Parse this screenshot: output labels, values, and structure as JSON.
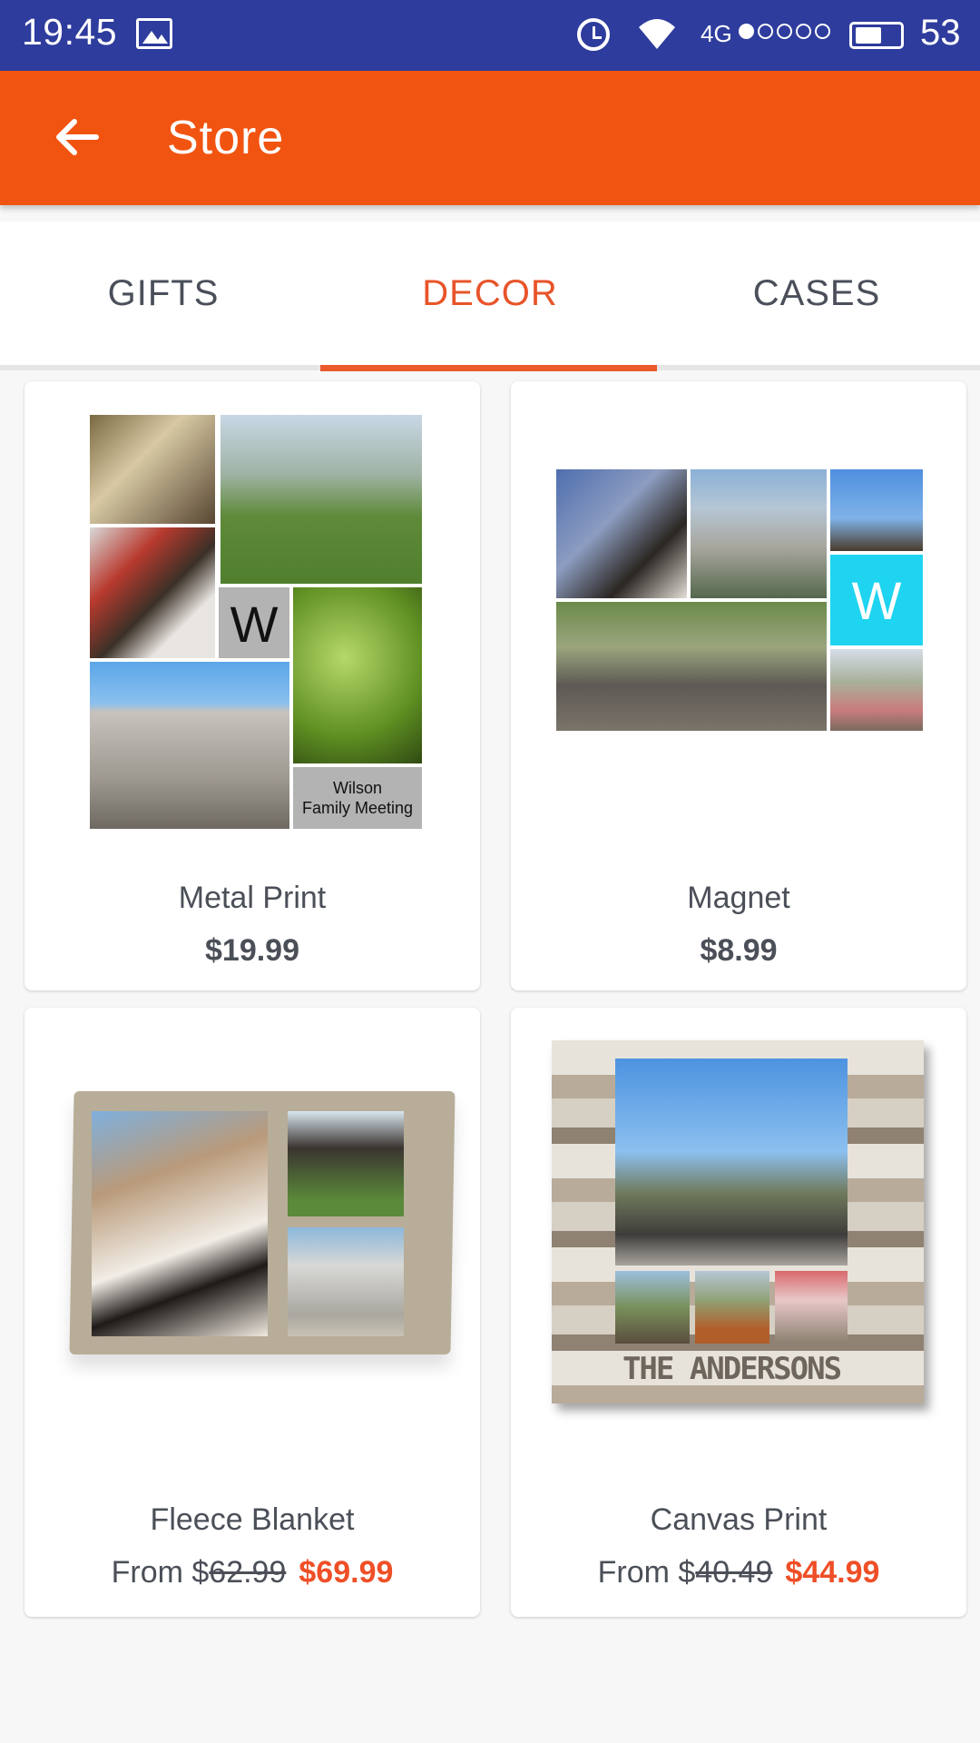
{
  "status_bar": {
    "time": "19:45",
    "network": "4G",
    "battery": "53",
    "icons": [
      "gallery-icon",
      "alarm-icon",
      "wifi-icon",
      "signal-icon",
      "battery-icon"
    ]
  },
  "app_bar": {
    "title": "Store",
    "back_icon": "arrow-left-icon"
  },
  "tabs": [
    {
      "label": "GIFTS",
      "active": false
    },
    {
      "label": "DECOR",
      "active": true
    },
    {
      "label": "CASES",
      "active": false
    }
  ],
  "products": [
    {
      "name": "Metal Print",
      "price": "$19.99",
      "tile_letter": "W",
      "tile_caption": "Wilson\nFamily Meeting"
    },
    {
      "name": "Magnet",
      "price": "$8.99",
      "tile_letter": "W"
    },
    {
      "name": "Fleece Blanket",
      "price_prefix": "From $",
      "old_price": "62.99",
      "new_price": "$69.99"
    },
    {
      "name": "Canvas Print",
      "price_prefix": "From $",
      "old_price": "40.49",
      "new_price": "$44.99",
      "canvas_caption": "THE ANDERSONS"
    }
  ],
  "colors": {
    "status_bar": "#2e3c9d",
    "app_bar": "#f15410",
    "accent": "#ea5a2a",
    "sale_price": "#ef4f27"
  }
}
